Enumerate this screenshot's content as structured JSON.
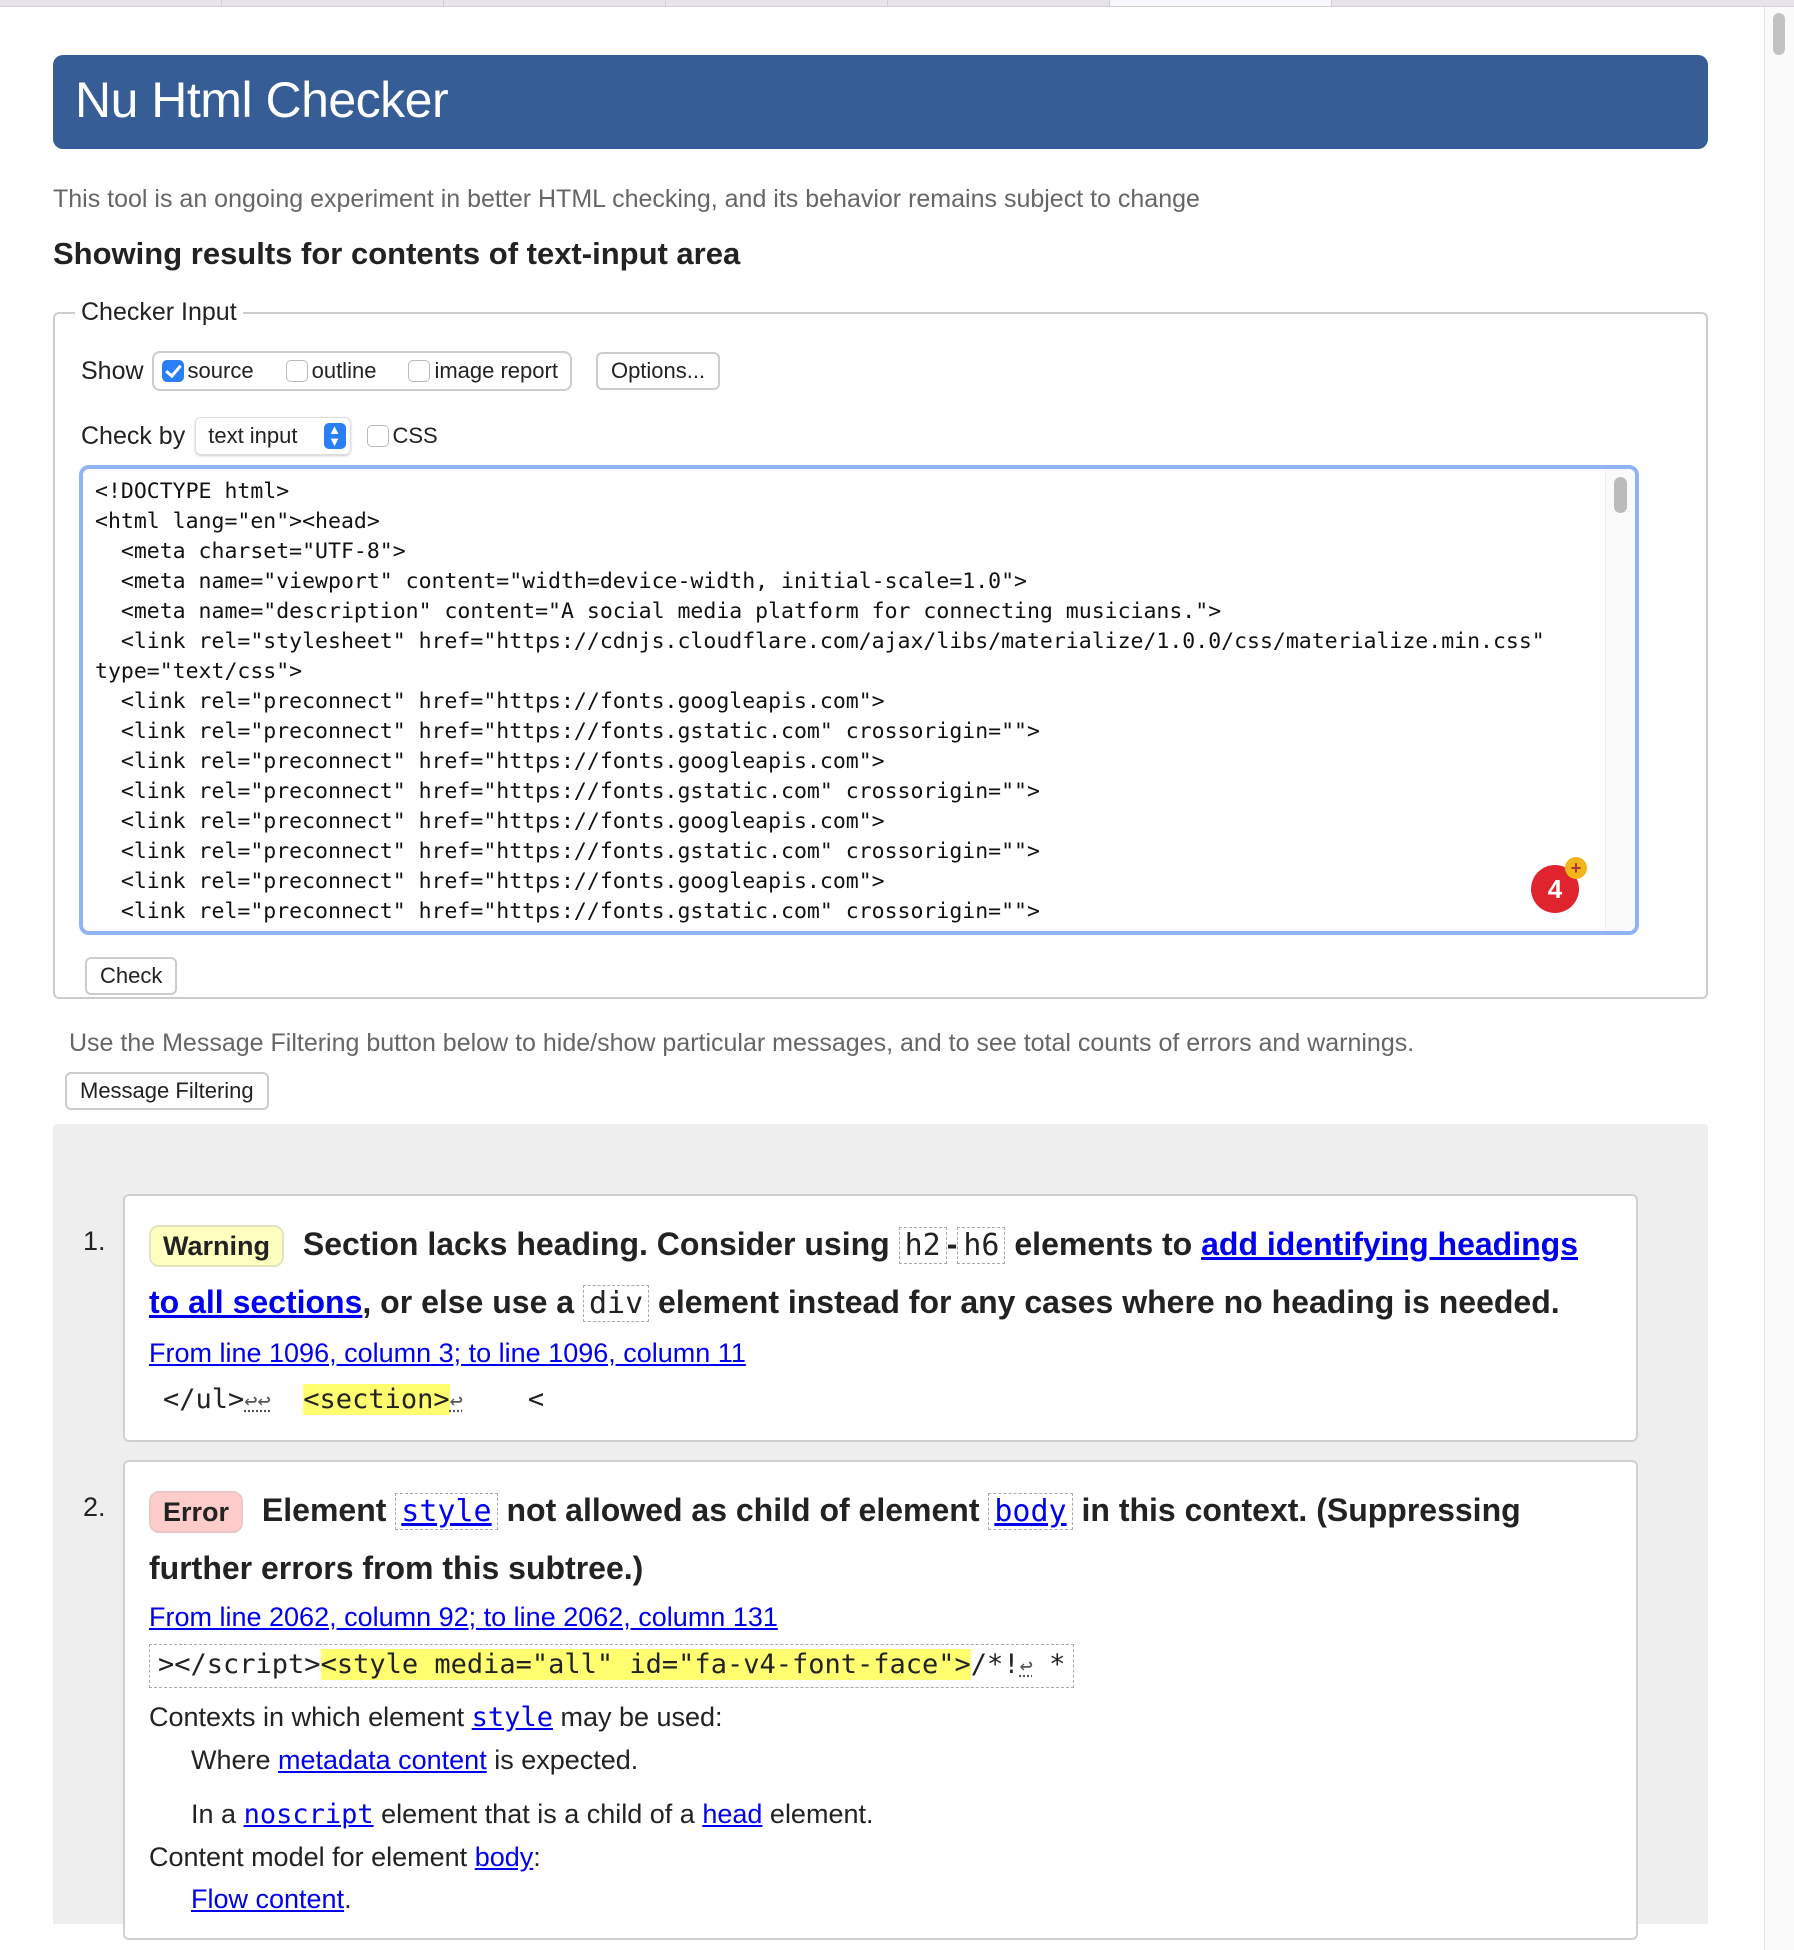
{
  "header": {
    "title": "Nu Html Checker"
  },
  "intro": "This tool is an ongoing experiment in better HTML checking, and its behavior remains subject to change",
  "showing": "Showing results for contents of text-input area",
  "input": {
    "legend": "Checker Input",
    "show_label": "Show",
    "show_options": [
      {
        "label": "source",
        "checked": true
      },
      {
        "label": "outline",
        "checked": false
      },
      {
        "label": "image report",
        "checked": false
      }
    ],
    "options_button": "Options...",
    "check_by_label": "Check by",
    "check_by_value": "text input",
    "css_label": "CSS",
    "source": "<!DOCTYPE html>\n<html lang=\"en\"><head>\n  <meta charset=\"UTF-8\">\n  <meta name=\"viewport\" content=\"width=device-width, initial-scale=1.0\">\n  <meta name=\"description\" content=\"A social media platform for connecting musicians.\">\n  <link rel=\"stylesheet\" href=\"https://cdnjs.cloudflare.com/ajax/libs/materialize/1.0.0/css/materialize.min.css\"\ntype=\"text/css\">\n  <link rel=\"preconnect\" href=\"https://fonts.googleapis.com\">\n  <link rel=\"preconnect\" href=\"https://fonts.gstatic.com\" crossorigin=\"\">\n  <link rel=\"preconnect\" href=\"https://fonts.googleapis.com\">\n  <link rel=\"preconnect\" href=\"https://fonts.gstatic.com\" crossorigin=\"\">\n  <link rel=\"preconnect\" href=\"https://fonts.googleapis.com\">\n  <link rel=\"preconnect\" href=\"https://fonts.gstatic.com\" crossorigin=\"\">\n  <link rel=\"preconnect\" href=\"https://fonts.googleapis.com\">\n  <link rel=\"preconnect\" href=\"https://fonts.gstatic.com\" crossorigin=\"\">",
    "badge_count": "4",
    "check_button": "Check"
  },
  "filtering": {
    "text": "Use the Message Filtering button below to hide/show particular messages, and to see total counts of errors and warnings.",
    "button": "Message Filtering"
  },
  "messages": [
    {
      "num": "1.",
      "type": "Warning",
      "t1": "Section lacks heading. Consider using",
      "c1": "h2",
      "dash": "-",
      "c2": "h6",
      "t2": "elements to",
      "link": "add identifying headings to all sections",
      "t3": ", or else use a",
      "c3": "div",
      "t4": "element instead for any cases where no heading is needed.",
      "location": "From line 1096, column 3; to line 1096, column 11",
      "ext_pre": "</ul>",
      "ext_ret1": "↩↩",
      "ext_hl": "<section>",
      "ext_ret2": "↩",
      "ext_post": "<"
    },
    {
      "num": "2.",
      "type": "Error",
      "t1": "Element",
      "c1": "style",
      "t2": "not allowed as child of element",
      "c2": "body",
      "t3": "in this context. (Suppressing further errors from this subtree.)",
      "location": "From line 2062, column 92; to line 2062, column 131",
      "ext_pre": "></script>",
      "ext_hl": "<style media=\"all\" id=\"fa-v4-font-face\">",
      "ext_post": "/*!",
      "ext_ret": "↩",
      "ext_end": " *",
      "contexts_pre": "Contexts in which element",
      "contexts_el": "style",
      "contexts_post": "may be used:",
      "where_pre": "Where",
      "where_link": "metadata content",
      "where_post": "is expected.",
      "in_pre": "In a",
      "in_link1": "noscript",
      "in_mid": "element that is a child of a",
      "in_link2": "head",
      "in_post": "element.",
      "model_pre": "Content model for element",
      "model_link": "body",
      "model_post": ":",
      "flow_link": "Flow content",
      "flow_post": "."
    }
  ]
}
